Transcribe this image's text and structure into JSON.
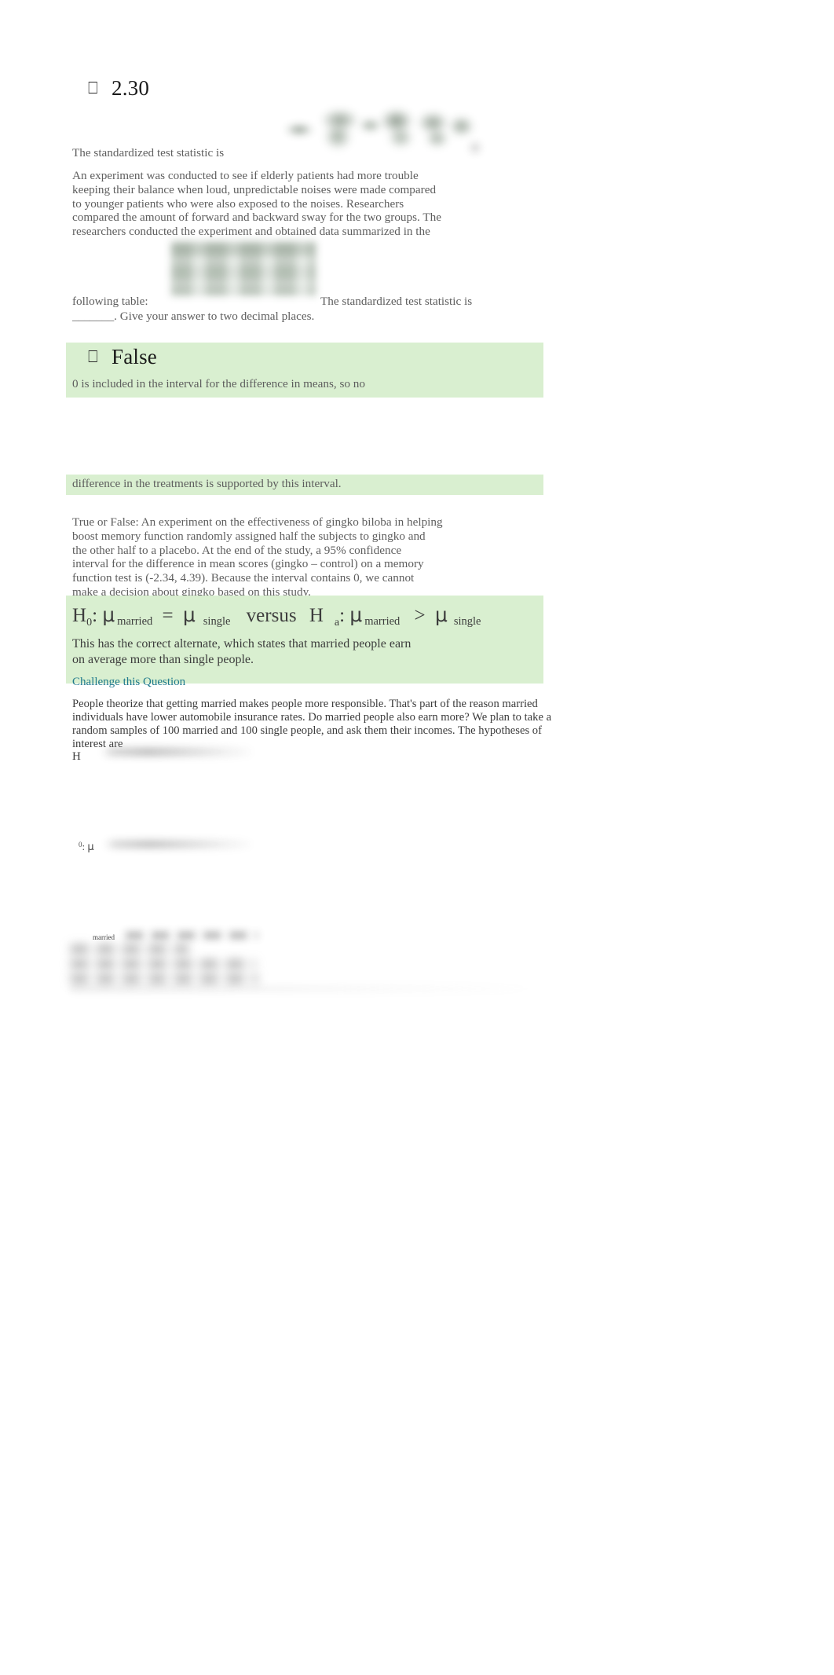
{
  "answer1": {
    "glyph": "⎕",
    "value": "2.30"
  },
  "prompt1": {
    "lead": "The standardized test statistic is",
    "body_lines": [
      "An experiment was conducted to see if elderly patients had more trouble",
      "keeping their balance when loud, unpredictable noises were made compared",
      "to younger patients who were also exposed to the noises. Researchers",
      "compared the amount of forward and backward sway for the two groups. The",
      "researchers conducted the experiment and obtained data summarized in the"
    ],
    "table_caption": "following table:",
    "trailing": "The standardized test statistic is",
    "closing": "_______. Give your answer to two decimal places.",
    "formula_alt": "blurred-formula-image",
    "table_alt": "blurred-data-table-image"
  },
  "answer2": {
    "glyph": "⎕",
    "value": "False",
    "explanation_line1": "0 is included in the interval for the difference in means, so no",
    "explanation_line2": "difference in the treatments is supported by this interval."
  },
  "prompt2": {
    "lines": [
      "True or False: An experiment on the effectiveness of gingko biloba in helping",
      "boost memory function randomly assigned half the subjects to gingko and",
      "the other half to a placebo. At the end of the study, a 95% confidence",
      "interval for the difference in mean scores (gingko – control) on a memory",
      "function test is (-2.34, 4.39). Because the interval contains 0, we cannot",
      "make a decision about gingko based on this study."
    ]
  },
  "answer3": {
    "hypothesis": {
      "h0": "H",
      "h0_sub": "0",
      "colon": ":",
      "mu": "μ",
      "sub_married": "married",
      "equals": "=",
      "sub_single": "single",
      "versus": "versus",
      "ha": "H",
      "ha_sub": "a",
      "greater": ">"
    },
    "explanation_line1": "This has the correct alternate, which states that married people earn",
    "explanation_line2": "on average more than single people.",
    "challenge_label": "Challenge this Question"
  },
  "prompt3": {
    "lines": [
      "People theorize that getting married makes people more responsible. That's part of the reason married",
      "individuals have lower automobile insurance rates. Do married people also earn more? We plan to take a",
      "random samples of 100 married and 100 single people, and ask them their incomes. The hypotheses of",
      "interest are"
    ],
    "h_label": "H",
    "h_sub_line": "0",
    "h_sub_colon": ":",
    "h_mu": "μ",
    "married_sub": "married"
  },
  "colors": {
    "highlight_green": "#d9efd0",
    "link_teal": "#1f7a8c",
    "body_text": "#5e5e5e",
    "heading_text": "#1a1a1a"
  }
}
